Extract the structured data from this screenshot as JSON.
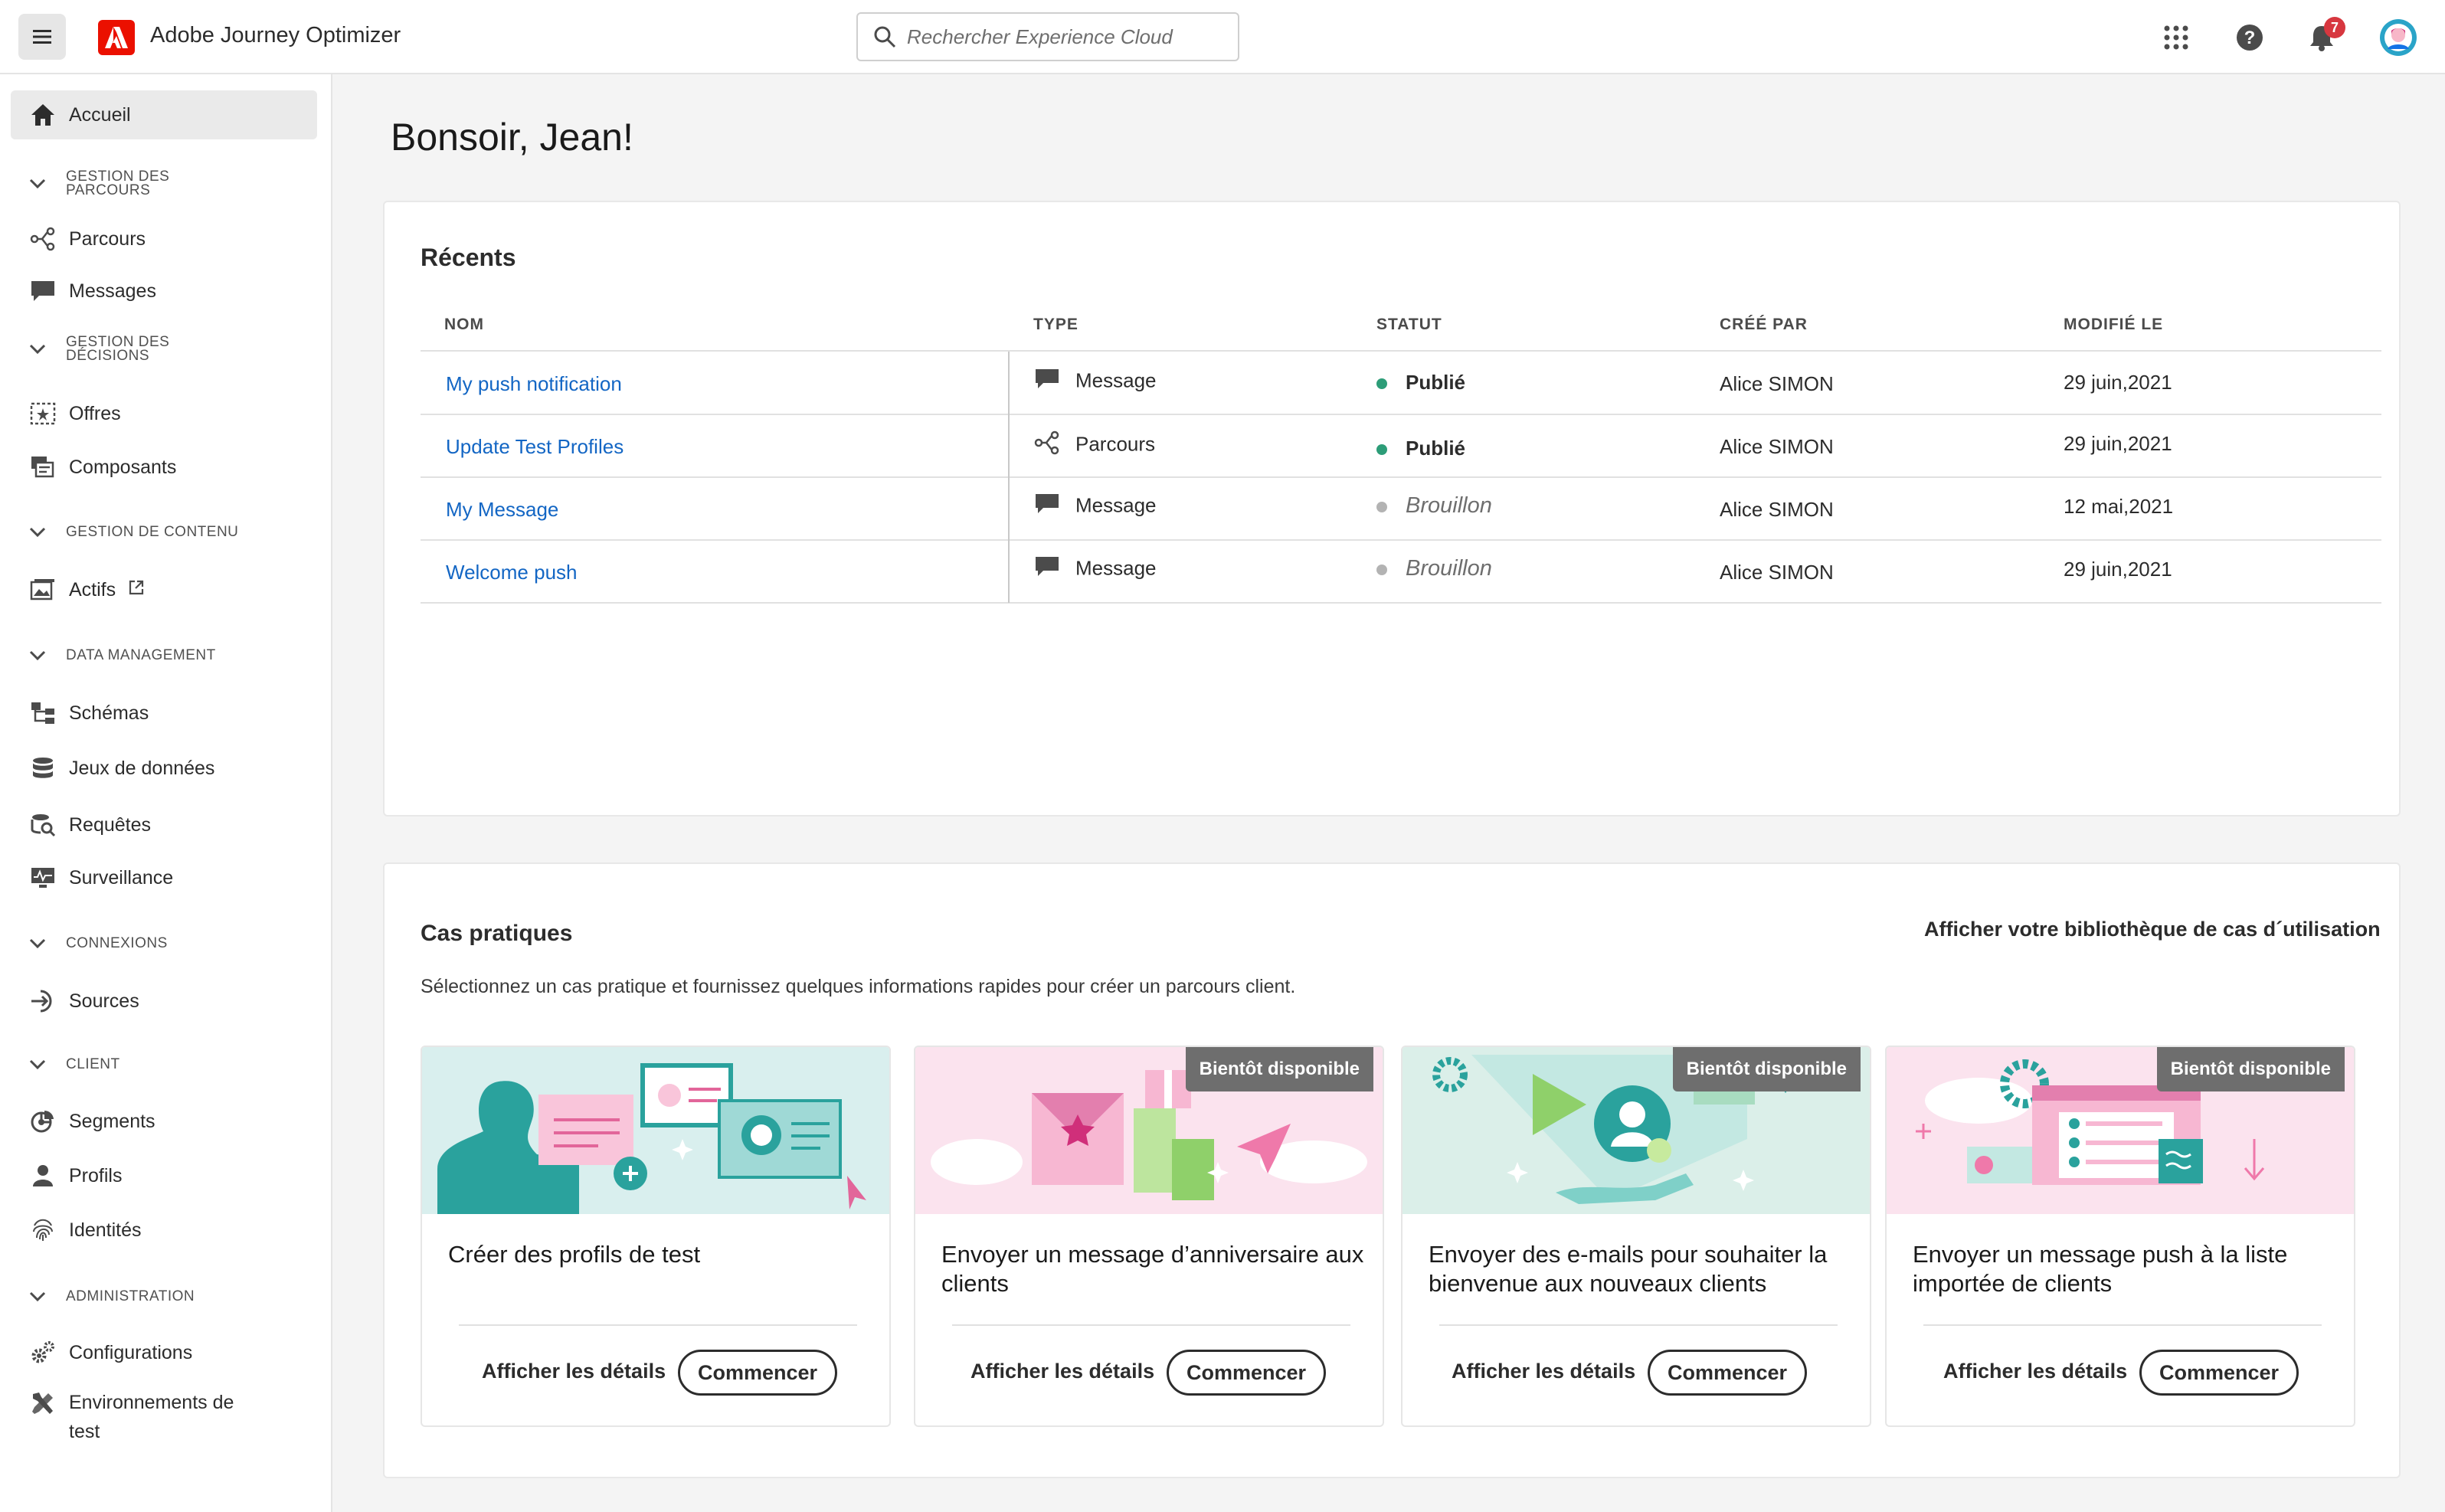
{
  "app": {
    "name": "Adobe Journey Optimizer",
    "search_placeholder": "Rechercher Experience Cloud",
    "notification_count": "7"
  },
  "sidebar": {
    "home": "Accueil",
    "sections": [
      {
        "title": "GESTION DES PARCOURS",
        "items": [
          "Parcours",
          "Messages"
        ]
      },
      {
        "title": "GESTION DES DÉCISIONS",
        "items": [
          "Offres",
          "Composants"
        ]
      },
      {
        "title": "GESTION DE CONTENU",
        "items": [
          "Actifs"
        ]
      },
      {
        "title": "DATA MANAGEMENT",
        "items": [
          "Schémas",
          "Jeux de données",
          "Requêtes",
          "Surveillance"
        ]
      },
      {
        "title": "CONNEXIONS",
        "items": [
          "Sources"
        ]
      },
      {
        "title": "CLIENT",
        "items": [
          "Segments",
          "Profils",
          "Identités"
        ]
      },
      {
        "title": "ADMINISTRATION",
        "items": [
          "Configurations",
          "Environnements de test"
        ]
      }
    ]
  },
  "greeting": "Bonsoir, Jean!",
  "recents": {
    "title": "Récents",
    "columns": [
      "NOM",
      "TYPE",
      "STATUT",
      "CRÉÉ PAR",
      "MODIFIÉ LE"
    ],
    "rows": [
      {
        "name": "My push notification",
        "type": "Message",
        "status": "Publié",
        "created_by": "Alice SIMON",
        "modified": "29 juin,2021"
      },
      {
        "name": "Update Test Profiles",
        "type": "Parcours",
        "status": "Publié",
        "created_by": "Alice SIMON",
        "modified": "29 juin,2021"
      },
      {
        "name": "My Message",
        "type": "Message",
        "status": "Brouillon",
        "created_by": "Alice SIMON",
        "modified": "12 mai,2021"
      },
      {
        "name": "Welcome push",
        "type": "Message",
        "status": "Brouillon",
        "created_by": "Alice SIMON",
        "modified": "29 juin,2021"
      }
    ]
  },
  "usecases": {
    "title": "Cas pratiques",
    "library_link": "Afficher votre bibliothèque de cas d´utilisation",
    "description": "Sélectionnez un cas pratique et fournissez quelques informations rapides pour créer un parcours client.",
    "details_label": "Afficher les détails",
    "start_label": "Commencer",
    "soon_label": "Bientôt disponible",
    "cards": [
      {
        "title": "Créer des profils de test"
      },
      {
        "title": "Envoyer un message d’anniversaire aux clients"
      },
      {
        "title": "Envoyer des e-mails pour souhaiter la bienvenue aux nouveaux clients"
      },
      {
        "title": "Envoyer un message push à la liste importée de clients"
      }
    ]
  },
  "colors": {
    "published": "#2d9d78",
    "draft": "#b3b3b3",
    "link": "#1366c4",
    "brand": "#eb1000"
  }
}
